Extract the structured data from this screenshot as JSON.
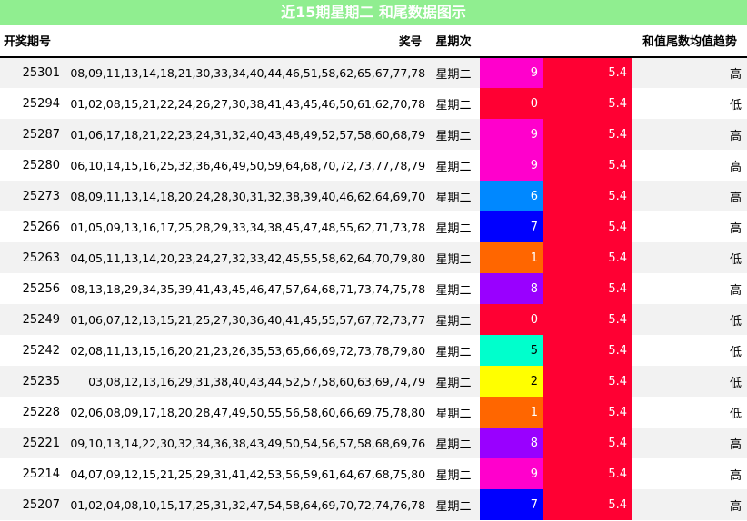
{
  "title": "近15期星期二 和尾数据图示",
  "headers": {
    "issue": "开奖期号",
    "numbers": "奖号",
    "weekday": "星期次",
    "tail": "和值尾数",
    "avg": "和值尾数均数",
    "trend": "和值尾数均值趋势"
  },
  "colors": {
    "title_bg": "#90ee90",
    "avg_bg": "#ff0033",
    "tail_palette": {
      "0": "#ff0033",
      "1": "#ff6600",
      "2": "#ffff00",
      "5": "#00ffcc",
      "6": "#0088ff",
      "7": "#0000ff",
      "8": "#9900ff",
      "9": "#ff00cc"
    }
  },
  "rows": [
    {
      "issue": "25301",
      "numbers": "08,09,11,13,14,18,21,30,33,34,40,44,46,51,58,62,65,67,77,78",
      "weekday": "星期二",
      "tail": "9",
      "avg": "5.4",
      "trend": "高"
    },
    {
      "issue": "25294",
      "numbers": "01,02,08,15,21,22,24,26,27,30,38,41,43,45,46,50,61,62,70,78",
      "weekday": "星期二",
      "tail": "0",
      "avg": "5.4",
      "trend": "低"
    },
    {
      "issue": "25287",
      "numbers": "01,06,17,18,21,22,23,24,31,32,40,43,48,49,52,57,58,60,68,79",
      "weekday": "星期二",
      "tail": "9",
      "avg": "5.4",
      "trend": "高"
    },
    {
      "issue": "25280",
      "numbers": "06,10,14,15,16,25,32,36,46,49,50,59,64,68,70,72,73,77,78,79",
      "weekday": "星期二",
      "tail": "9",
      "avg": "5.4",
      "trend": "高"
    },
    {
      "issue": "25273",
      "numbers": "08,09,11,13,14,18,20,24,28,30,31,32,38,39,40,46,62,64,69,70",
      "weekday": "星期二",
      "tail": "6",
      "avg": "5.4",
      "trend": "高"
    },
    {
      "issue": "25266",
      "numbers": "01,05,09,13,16,17,25,28,29,33,34,38,45,47,48,55,62,71,73,78",
      "weekday": "星期二",
      "tail": "7",
      "avg": "5.4",
      "trend": "高"
    },
    {
      "issue": "25263",
      "numbers": "04,05,11,13,14,20,23,24,27,32,33,42,45,55,58,62,64,70,79,80",
      "weekday": "星期二",
      "tail": "1",
      "avg": "5.4",
      "trend": "低"
    },
    {
      "issue": "25256",
      "numbers": "08,13,18,29,34,35,39,41,43,45,46,47,57,64,68,71,73,74,75,78",
      "weekday": "星期二",
      "tail": "8",
      "avg": "5.4",
      "trend": "高"
    },
    {
      "issue": "25249",
      "numbers": "01,06,07,12,13,15,21,25,27,30,36,40,41,45,55,57,67,72,73,77",
      "weekday": "星期二",
      "tail": "0",
      "avg": "5.4",
      "trend": "低"
    },
    {
      "issue": "25242",
      "numbers": "02,08,11,13,15,16,20,21,23,26,35,53,65,66,69,72,73,78,79,80",
      "weekday": "星期二",
      "tail": "5",
      "avg": "5.4",
      "trend": "低"
    },
    {
      "issue": "25235",
      "numbers": "03,08,12,13,16,29,31,38,40,43,44,52,57,58,60,63,69,74,79",
      "weekday": "星期二",
      "tail": "2",
      "avg": "5.4",
      "trend": "低"
    },
    {
      "issue": "25228",
      "numbers": "02,06,08,09,17,18,20,28,47,49,50,55,56,58,60,66,69,75,78,80",
      "weekday": "星期二",
      "tail": "1",
      "avg": "5.4",
      "trend": "低"
    },
    {
      "issue": "25221",
      "numbers": "09,10,13,14,22,30,32,34,36,38,43,49,50,54,56,57,58,68,69,76",
      "weekday": "星期二",
      "tail": "8",
      "avg": "5.4",
      "trend": "高"
    },
    {
      "issue": "25214",
      "numbers": "04,07,09,12,15,21,25,29,31,41,42,53,56,59,61,64,67,68,75,80",
      "weekday": "星期二",
      "tail": "9",
      "avg": "5.4",
      "trend": "高"
    },
    {
      "issue": "25207",
      "numbers": "01,02,04,08,10,15,17,25,31,32,47,54,58,64,69,70,72,74,76,78",
      "weekday": "星期二",
      "tail": "7",
      "avg": "5.4",
      "trend": "高"
    }
  ]
}
